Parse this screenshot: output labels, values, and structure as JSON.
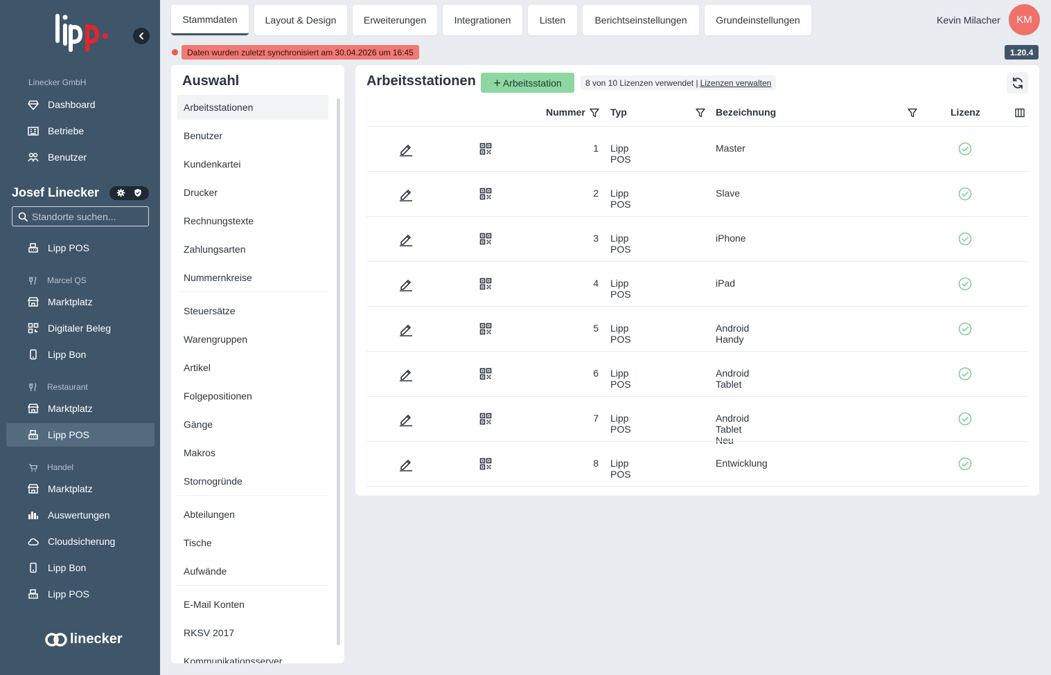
{
  "sidebar": {
    "company": "Linecker GmbH",
    "top_items": [
      {
        "label": "Dashboard",
        "icon": "diamond-icon"
      },
      {
        "label": "Betriebe",
        "icon": "building-icon"
      },
      {
        "label": "Benutzer",
        "icon": "users-icon"
      }
    ],
    "user_name": "Josef Linecker",
    "search_placeholder": "Standorte suchen...",
    "first_item": {
      "label": "Lipp POS",
      "icon": "register-icon"
    },
    "groups": [
      {
        "label": "Marcel QS",
        "icon": "cutlery-icon",
        "items": [
          {
            "label": "Marktplatz",
            "icon": "store-icon"
          },
          {
            "label": "Digitaler Beleg",
            "icon": "qr-icon"
          },
          {
            "label": "Lipp Bon",
            "icon": "phone-icon"
          }
        ]
      },
      {
        "label": "Restaurant",
        "icon": "cutlery-icon",
        "items": [
          {
            "label": "Marktplatz",
            "icon": "store-icon"
          },
          {
            "label": "Lipp POS",
            "icon": "register-icon",
            "active": true
          }
        ]
      },
      {
        "label": "Handel",
        "icon": "cart-icon",
        "items": [
          {
            "label": "Marktplatz",
            "icon": "store-icon"
          },
          {
            "label": "Auswertungen",
            "icon": "bar-chart-icon"
          },
          {
            "label": "Cloudsicherung",
            "icon": "cloud-icon"
          },
          {
            "label": "Lipp Bon",
            "icon": "phone-icon"
          },
          {
            "label": "Lipp POS",
            "icon": "register-icon"
          }
        ]
      }
    ],
    "footer_brand": "linecker"
  },
  "topbar": {
    "tabs": [
      "Stammdaten",
      "Layout & Design",
      "Erweiterungen",
      "Integrationen",
      "Listen",
      "Berichtseinstellungen",
      "Grundeinstellungen"
    ],
    "active_tab": "Stammdaten",
    "user_name": "Kevin Milacher",
    "avatar_initials": "KM",
    "sync_message": "Daten wurden zuletzt synchronisiert am 30.04.2026 um 16:45",
    "version": "1.20.4"
  },
  "auswahl": {
    "title": "Auswahl",
    "groups": [
      [
        "Arbeitsstationen",
        "Benutzer",
        "Kundenkartei",
        "Drucker",
        "Rechnungstexte",
        "Zahlungsarten",
        "Nummernkreise"
      ],
      [
        "Steuersätze",
        "Warengruppen",
        "Artikel",
        "Folgepositionen",
        "Gänge",
        "Makros",
        "Stornogründe"
      ],
      [
        "Abteilungen",
        "Tische",
        "Aufwände"
      ],
      [
        "E-Mail Konten",
        "RKSV 2017",
        "Kommunikationsserver"
      ]
    ],
    "active": "Arbeitsstationen"
  },
  "main": {
    "title": "Arbeitsstationen",
    "add_button": "Arbeitsstation",
    "license_text": "8 von 10 Lizenzen verwendet |",
    "license_link": "Lizenzen verwalten",
    "columns": {
      "nummer": "Nummer",
      "typ": "Typ",
      "bezeichnung": "Bezeichnung",
      "lizenz": "Lizenz"
    },
    "rows": [
      {
        "nummer": "1",
        "typ": "Lipp POS",
        "bezeichnung": "Master",
        "lizenz": true
      },
      {
        "nummer": "2",
        "typ": "Lipp POS",
        "bezeichnung": "Slave",
        "lizenz": true
      },
      {
        "nummer": "3",
        "typ": "Lipp POS",
        "bezeichnung": "iPhone",
        "lizenz": true
      },
      {
        "nummer": "4",
        "typ": "Lipp POS",
        "bezeichnung": "iPad",
        "lizenz": true
      },
      {
        "nummer": "5",
        "typ": "Lipp POS",
        "bezeichnung": "Android Handy",
        "lizenz": true
      },
      {
        "nummer": "6",
        "typ": "Lipp POS",
        "bezeichnung": "Android Tablet",
        "lizenz": true
      },
      {
        "nummer": "7",
        "typ": "Lipp POS",
        "bezeichnung": "Android Tablet Neu",
        "lizenz": true
      },
      {
        "nummer": "8",
        "typ": "Lipp POS",
        "bezeichnung": "Entwicklung",
        "lizenz": true
      }
    ]
  },
  "colors": {
    "sidebar": "#3f5569",
    "accent_green": "#8ed7a2",
    "check_green": "#7fd095",
    "alert_red": "#f07a75",
    "avatar": "#f0706a"
  }
}
